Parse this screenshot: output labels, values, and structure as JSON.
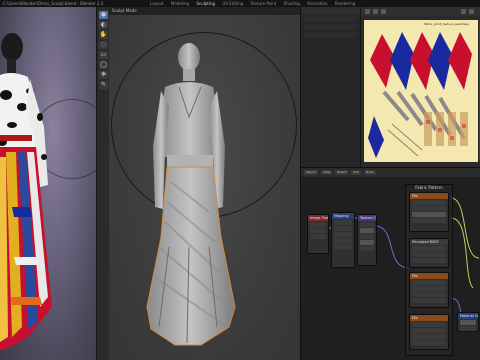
{
  "window": {
    "title": "C:\\Users\\Blender\\Dress_Sculpt.blend - Blender 3.3",
    "tabs": [
      "Layout",
      "Modeling",
      "Sculpting",
      "UV Editing",
      "Texture Paint",
      "Shading",
      "Animation",
      "Rendering"
    ],
    "active_tab": "Sculpting"
  },
  "viewport": {
    "mode_label": "Sculpt Mode"
  },
  "toolbar": {
    "tools": [
      {
        "icon": "draw-brush-icon",
        "glyph": "●"
      },
      {
        "icon": "smooth-brush-icon",
        "glyph": "◐"
      },
      {
        "icon": "grab-brush-icon",
        "glyph": "✋"
      },
      {
        "icon": "mask-brush-icon",
        "glyph": "◌"
      },
      {
        "icon": "box-mask-icon",
        "glyph": "▭"
      },
      {
        "icon": "lasso-mask-icon",
        "glyph": "◯"
      },
      {
        "icon": "transform-icon",
        "glyph": "✥"
      },
      {
        "icon": "annotate-icon",
        "glyph": "✎"
      }
    ],
    "active_index": 0
  },
  "uv_editor": {
    "image_caption": "fabric_print_texture_seamless"
  },
  "node_editor": {
    "frame_label": "Fabric Pattern",
    "nodes": [
      {
        "name": "Image Texture",
        "color": "red"
      },
      {
        "name": "Mapping",
        "color": "blue"
      },
      {
        "name": "Texture Coordinate",
        "color": "purple"
      },
      {
        "name": "Mix",
        "color": "orange"
      },
      {
        "name": "Principled BSDF",
        "color": "dark"
      },
      {
        "name": "Material Output",
        "color": "blue"
      }
    ],
    "header_chips": [
      "Object",
      "View",
      "Select",
      "Add",
      "Node"
    ]
  },
  "colors": {
    "accent": "#4772b3",
    "texture_bg": "#f4e8b0",
    "texture_red": "#c8102e",
    "texture_blue": "#1a2a9e"
  }
}
